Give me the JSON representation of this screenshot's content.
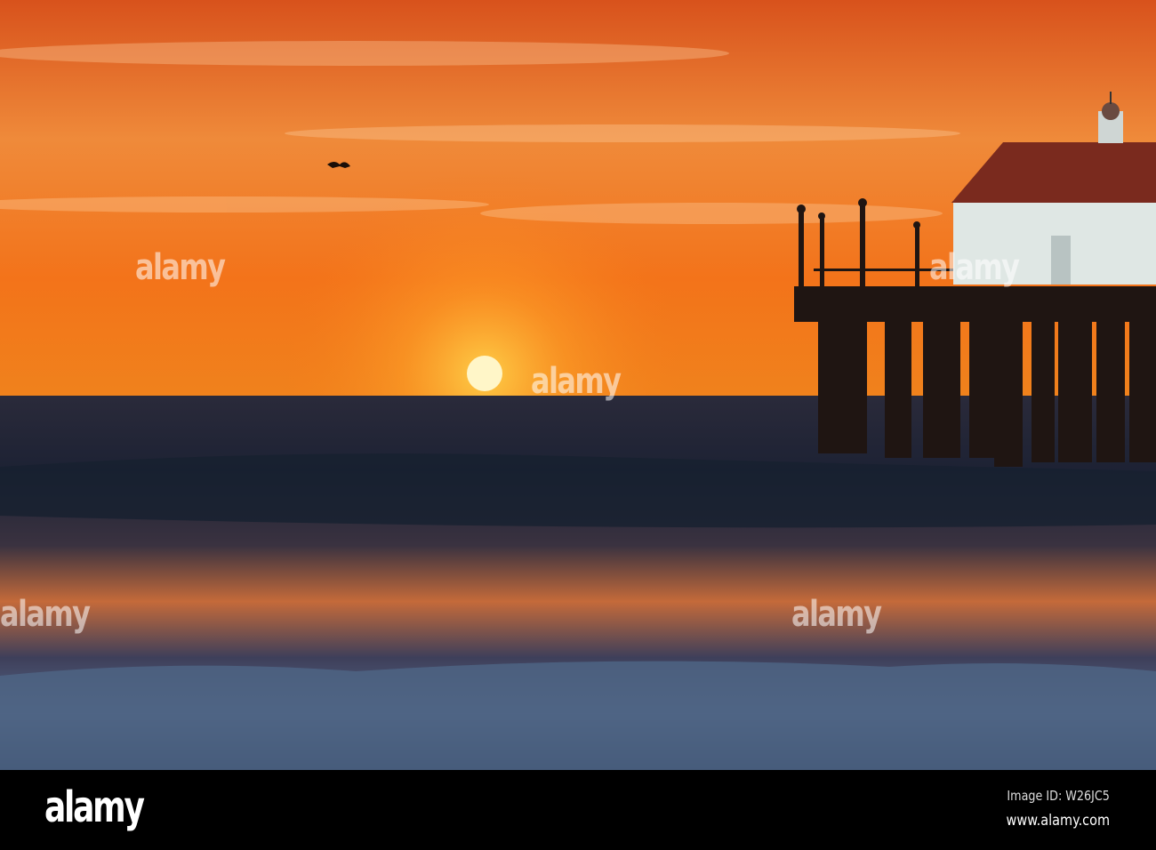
{
  "watermark": {
    "text": "alamy"
  },
  "footer": {
    "logo": "alamy",
    "image_id": "Image ID: W26JC5",
    "url": "www.alamy.com"
  },
  "colors": {
    "sky_top": "#d9531a",
    "sky_horizon": "#f08a1e",
    "sun": "#fff4c0",
    "sea": "#1c2436",
    "bar": "#000000"
  }
}
